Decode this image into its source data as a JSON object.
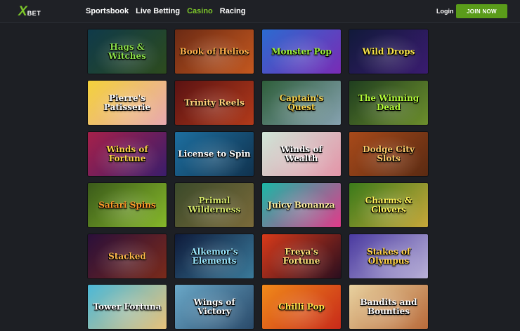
{
  "brand": {
    "x": "X",
    "bet": "BET"
  },
  "nav": [
    {
      "label": "Sportsbook",
      "active": false
    },
    {
      "label": "Live Betting",
      "active": false
    },
    {
      "label": "Casino",
      "active": true
    },
    {
      "label": "Racing",
      "active": false
    }
  ],
  "login_label": "Login",
  "join_label": "JOIN NOW",
  "games": [
    {
      "title": "Hags & Witches",
      "bg": [
        "#0f3a4a",
        "#2d4b1d"
      ],
      "color": "#8be04a"
    },
    {
      "title": "Book of Helios",
      "bg": [
        "#6b2a14",
        "#c4581f"
      ],
      "color": "#ffb04a"
    },
    {
      "title": "Monster Pop",
      "bg": [
        "#2b6bd0",
        "#7a2bb5"
      ],
      "color": "#9cf03a"
    },
    {
      "title": "Wild Drops",
      "bg": [
        "#111a3a",
        "#3a1b70"
      ],
      "color": "#f6e24a"
    },
    {
      "title": "Pierre's Patisserie",
      "bg": [
        "#f4d23a",
        "#e8a8b0"
      ],
      "color": "#ffffff"
    },
    {
      "title": "Trinity Reels",
      "bg": [
        "#5a1212",
        "#b23a1a"
      ],
      "color": "#ffd27a"
    },
    {
      "title": "Captain's Quest",
      "bg": [
        "#2e5e3a",
        "#86a2b0"
      ],
      "color": "#f7d24a"
    },
    {
      "title": "The Winning Dead",
      "bg": [
        "#1f3e1f",
        "#6c8e2c"
      ],
      "color": "#b6ff3a"
    },
    {
      "title": "Winds of Fortune",
      "bg": [
        "#a6204a",
        "#3a1d6b"
      ],
      "color": "#ffd24a"
    },
    {
      "title": "License to Spin",
      "bg": [
        "#1d6fa0",
        "#10324e"
      ],
      "color": "#ffffff"
    },
    {
      "title": "Winds of Wealth",
      "bg": [
        "#cfe6d8",
        "#e494a8"
      ],
      "color": "#ffffff"
    },
    {
      "title": "Dodge City Slots",
      "bg": [
        "#a84a1a",
        "#5a2a12"
      ],
      "color": "#ffcb6a"
    },
    {
      "title": "Safari Spins",
      "bg": [
        "#3a5a1a",
        "#86b82a"
      ],
      "color": "#ff9a2a"
    },
    {
      "title": "Primal Wilderness",
      "bg": [
        "#3b4a2a",
        "#7a6a3a"
      ],
      "color": "#d6e86a"
    },
    {
      "title": "Juicy Bonanza",
      "bg": [
        "#1ab8a6",
        "#e23a8a"
      ],
      "color": "#fff0a0"
    },
    {
      "title": "Charms & Clovers",
      "bg": [
        "#3a7a1a",
        "#c8a83a"
      ],
      "color": "#fff25a"
    },
    {
      "title": "Stacked",
      "bg": [
        "#2a0f3a",
        "#7a2a1a"
      ],
      "color": "#ffb84a"
    },
    {
      "title": "Alkemor's Elements",
      "bg": [
        "#0e1a3a",
        "#3a7a9a"
      ],
      "color": "#9ae8ff"
    },
    {
      "title": "Freya's Fortune",
      "bg": [
        "#d83a1a",
        "#2a0e1e"
      ],
      "color": "#ffe27a"
    },
    {
      "title": "Stakes of Olympus",
      "bg": [
        "#4a3aa0",
        "#bab2d8"
      ],
      "color": "#ffd24a"
    },
    {
      "title": "Tower Fortuna",
      "bg": [
        "#4ab8d8",
        "#e8c27a"
      ],
      "color": "#ffffff"
    },
    {
      "title": "Wings of Victory",
      "bg": [
        "#6aa8c8",
        "#2a4a6a"
      ],
      "color": "#ffffff"
    },
    {
      "title": "Chilli Pop",
      "bg": [
        "#f08a1a",
        "#c82a1a"
      ],
      "color": "#ffe24a"
    },
    {
      "title": "Bandits and Bounties",
      "bg": [
        "#e8d2a0",
        "#b86a3a"
      ],
      "color": "#ffffff"
    }
  ]
}
